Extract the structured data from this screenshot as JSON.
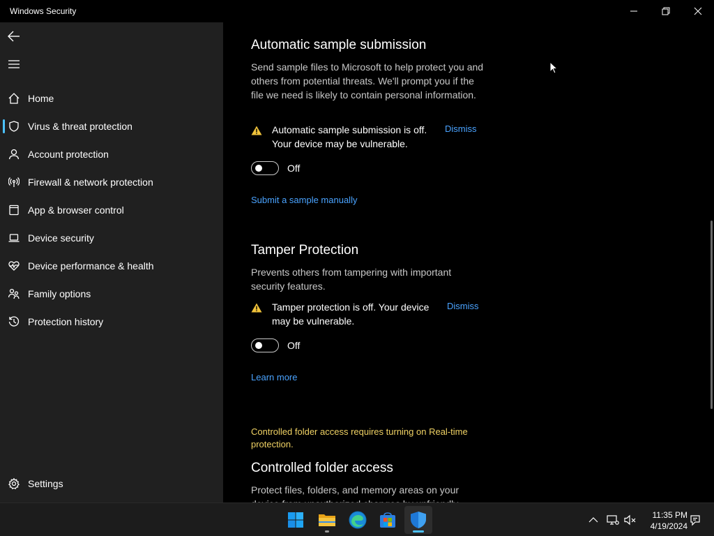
{
  "window": {
    "title": "Windows Security"
  },
  "sidebar": {
    "items": [
      {
        "label": "Home",
        "icon": "home-icon"
      },
      {
        "label": "Virus & threat protection",
        "icon": "shield-icon",
        "active": true
      },
      {
        "label": "Account protection",
        "icon": "person-icon"
      },
      {
        "label": "Firewall & network protection",
        "icon": "antenna-icon"
      },
      {
        "label": "App & browser control",
        "icon": "app-window-icon"
      },
      {
        "label": "Device security",
        "icon": "laptop-icon"
      },
      {
        "label": "Device performance & health",
        "icon": "heart-pulse-icon"
      },
      {
        "label": "Family options",
        "icon": "family-icon"
      },
      {
        "label": "Protection history",
        "icon": "history-icon"
      }
    ],
    "settings_label": "Settings"
  },
  "main": {
    "sample_submission": {
      "title": "Automatic sample submission",
      "description": "Send sample files to Microsoft to help protect you and others from potential threats. We'll prompt you if the file we need is likely to contain personal information.",
      "warning": "Automatic sample submission is off. Your device may be vulnerable.",
      "dismiss": "Dismiss",
      "toggle_state": "Off",
      "link": "Submit a sample manually"
    },
    "tamper": {
      "title": "Tamper Protection",
      "description": "Prevents others from tampering with important security features.",
      "warning": "Tamper protection is off. Your device may be vulnerable.",
      "dismiss": "Dismiss",
      "toggle_state": "Off",
      "link": "Learn more"
    },
    "controlled_folder": {
      "notice": "Controlled folder access requires turning on Real-time protection.",
      "title": "Controlled folder access",
      "description": "Protect files, folders, and memory areas on your device from unauthorized changes by unfriendly"
    }
  },
  "taskbar": {
    "apps": [
      "windows-start-icon",
      "file-explorer-icon",
      "edge-icon",
      "store-icon",
      "windows-security-icon"
    ],
    "clock": {
      "time": "11:35 PM",
      "date": "4/19/2024"
    }
  },
  "colors": {
    "accent": "#4cc2ff",
    "link": "#4aa3ff",
    "warning": "#f0d264",
    "sidebar_bg": "#202020"
  }
}
